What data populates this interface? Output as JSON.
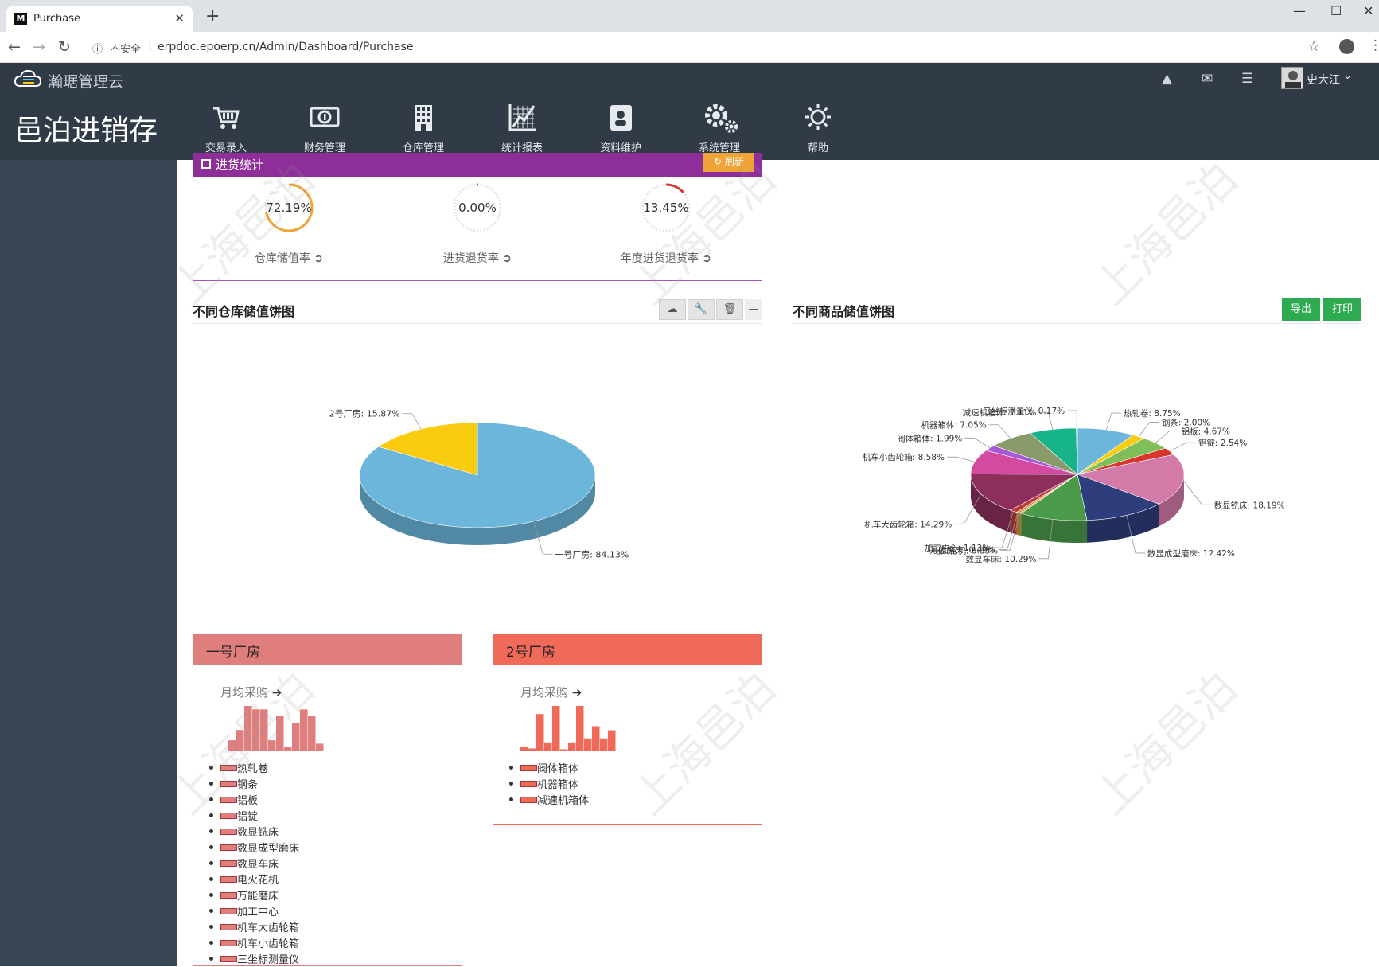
{
  "browser": {
    "tab_title": "Purchase",
    "favicon_letter": "M",
    "url_security": "不安全",
    "url": "erpdoc.epoerp.cn/Admin/Dashboard/Purchase"
  },
  "header": {
    "product_name": "瀚琚管理云",
    "username": "史大江"
  },
  "app_title": "邑泊进销存",
  "nav": [
    {
      "label": "交易录入",
      "icon": "shopping-cart-icon"
    },
    {
      "label": "财务管理",
      "icon": "money-icon"
    },
    {
      "label": "仓库管理",
      "icon": "building-icon"
    },
    {
      "label": "统计报表",
      "icon": "chart-icon"
    },
    {
      "label": "资料维护",
      "icon": "contact-icon"
    },
    {
      "label": "系统管理",
      "icon": "gears-icon"
    },
    {
      "label": "帮助",
      "icon": "sun-icon"
    }
  ],
  "stats": {
    "title": "进货统计",
    "refresh_label": "刷新",
    "gauges": [
      {
        "value": "72.19%",
        "label": "仓库储值率",
        "fraction": 0.7219,
        "color": "#f0a336"
      },
      {
        "value": "0.00%",
        "label": "进货退货率",
        "fraction": 0.0,
        "color": "#555555"
      },
      {
        "value": "13.45%",
        "label": "年度进货退货率",
        "fraction": 0.1345,
        "color": "#d9352b"
      }
    ]
  },
  "warehouse_pie": {
    "title": "不同仓库储值饼图",
    "tools": [
      "cloud-upload-icon",
      "wrench-icon",
      "trash-icon"
    ]
  },
  "product_pie": {
    "title": "不同商品储值饼图",
    "export_label": "导出",
    "print_label": "打印"
  },
  "chart_data": [
    {
      "type": "pie",
      "title": "不同仓库储值饼图",
      "labels": [
        "一号厂房",
        "2号厂房"
      ],
      "values": [
        84.13,
        15.87
      ],
      "colors": [
        "#6cb5db",
        "#f9cb11"
      ]
    },
    {
      "type": "pie",
      "title": "不同商品储值饼图",
      "labels": [
        "热轧卷",
        "钢条",
        "铝板",
        "铝锭",
        "数显铣床",
        "数显成型磨床",
        "数显车床",
        "电火花机",
        "万能磨床",
        "加工中心",
        "机车大齿轮箱",
        "机车小齿轮箱",
        "阀体箱体",
        "机器箱体",
        "减速机箱体",
        "三坐标测量仪"
      ],
      "values": [
        8.75,
        2.0,
        4.67,
        2.54,
        18.19,
        12.42,
        10.29,
        0.33,
        0.49,
        1.13,
        14.29,
        8.58,
        1.99,
        7.05,
        7.11,
        0.17
      ],
      "colors": [
        "#6cb5db",
        "#f9cb11",
        "#7fbf5a",
        "#d9352b",
        "#d47aa8",
        "#2e3d7c",
        "#4a9a4a",
        "#bfa13a",
        "#e58a3a",
        "#b83a3a",
        "#8c2f5c",
        "#d44aa0",
        "#a55bd8",
        "#8a9a6a",
        "#17b389",
        "#2a8a6a"
      ],
      "display_labels": [
        "热轧卷: 8.75%",
        "钢条: 2.00%",
        "铝板: 4.67%",
        "铝锭: 2.54%",
        "数显铣床: 18.19%",
        "数显成型磨床: 12.42%",
        "数显车床: 10.29%",
        "电火花机: 0.33%",
        "万能磨床: 0.49%",
        "加工中心: 1.13%",
        "机车大齿轮箱: 14.29%",
        "机车小齿轮箱: 8.58%",
        "阀体箱体: 1.99%",
        "机器箱体: 7.05%",
        "减速机箱体: 7.11%",
        "三坐标测量仪: 0.17%"
      ]
    },
    {
      "type": "bar",
      "title": "一号厂房",
      "values": [
        3,
        6,
        13,
        12,
        12,
        3,
        10,
        1,
        8,
        12,
        10,
        2
      ],
      "color": "#e07e7e"
    },
    {
      "type": "bar",
      "title": "2号厂房",
      "values": [
        1,
        0.5,
        9,
        2,
        11,
        0,
        2,
        11,
        3,
        6,
        3,
        5
      ],
      "color": "#f06a5a"
    }
  ],
  "warehouse_pie_labels": [
    "一号厂房: 84.13%",
    "2号厂房: 15.87%"
  ],
  "cards": [
    {
      "title": "一号厂房",
      "header_color": "#e07e7e",
      "border_color": "#e07e7e",
      "monthly_label": "月均采购",
      "items": [
        "热轧卷",
        "钢条",
        "铝板",
        "铝锭",
        "数显铣床",
        "数显成型磨床",
        "数显车床",
        "电火花机",
        "万能磨床",
        "加工中心",
        "机车大齿轮箱",
        "机车小齿轮箱",
        "三坐标测量仪"
      ]
    },
    {
      "title": "2号厂房",
      "header_color": "#f06a5a",
      "border_color": "#f06a5a",
      "monthly_label": "月均采购",
      "items": [
        "阀体箱体",
        "机器箱体",
        "减速机箱体"
      ]
    }
  ],
  "watermark": "上海邑泊"
}
